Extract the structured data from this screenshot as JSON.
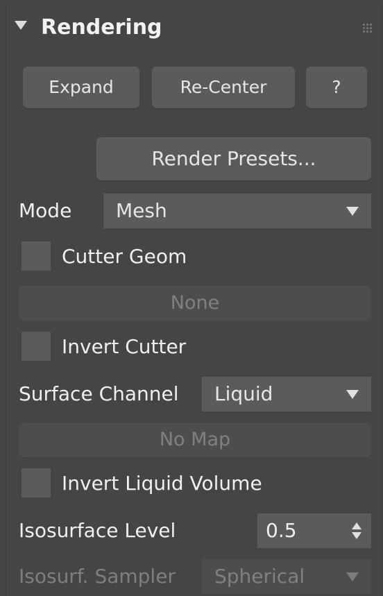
{
  "panel": {
    "title": "Rendering"
  },
  "buttons": {
    "expand": "Expand",
    "recenter": "Re-Center",
    "help": "?",
    "render_presets": "Render Presets...",
    "cutter_geom_pick": "None",
    "surface_map_pick": "No Map"
  },
  "mode": {
    "label": "Mode",
    "value": "Mesh"
  },
  "cutter_geom": {
    "label": "Cutter Geom",
    "checked": false
  },
  "invert_cutter": {
    "label": "Invert Cutter",
    "checked": false
  },
  "surface_channel": {
    "label": "Surface Channel",
    "value": "Liquid"
  },
  "invert_liquid_volume": {
    "label": "Invert Liquid Volume",
    "checked": false
  },
  "isosurface_level": {
    "label": "Isosurface Level",
    "value": "0.5"
  },
  "isosurf_sampler": {
    "label": "Isosurf. Sampler",
    "value": "Spherical",
    "enabled": false
  },
  "colors": {
    "panel_bg": "#454545",
    "control_bg": "#5b5b5b",
    "text": "#f0f0f0",
    "disabled_text": "#808080"
  },
  "icons": {
    "collapse": "triangle-down-icon",
    "grip": "grip-dots-icon",
    "dropdown": "chevron-down-icon",
    "spinner": "spinner-arrows-icon"
  }
}
